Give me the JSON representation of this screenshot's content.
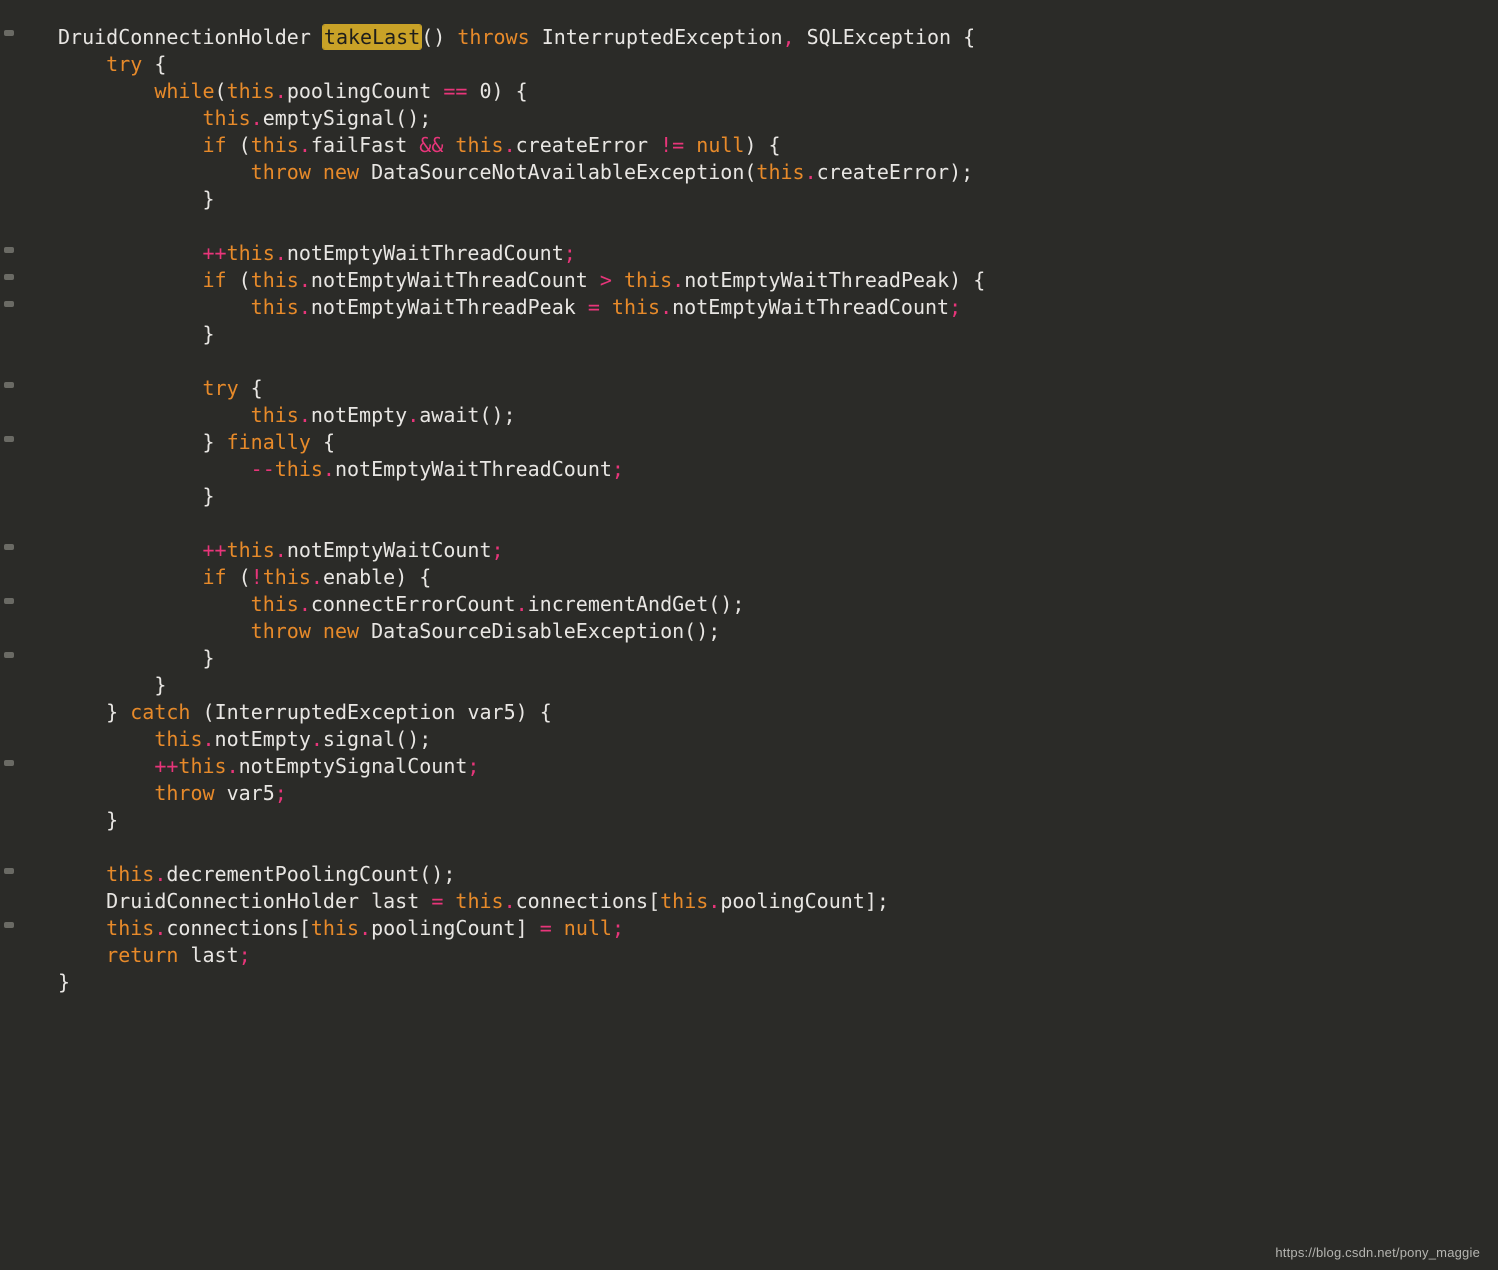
{
  "code": {
    "t": {
      "DruidConnectionHolder": "DruidConnectionHolder",
      "takeLast": "takeLast",
      "throws": "throws",
      "InterruptedException": "InterruptedException",
      "SQLException": "SQLException",
      "try": "try",
      "while": "while",
      "this": "this",
      "poolingCount": "poolingCount",
      "zero": "0",
      "emptySignal": "emptySignal",
      "if": "if",
      "failFast": "failFast",
      "createError": "createError",
      "null": "null",
      "throw": "throw",
      "new": "new",
      "DataSourceNotAvailableException": "DataSourceNotAvailableException",
      "notEmptyWaitThreadCount": "notEmptyWaitThreadCount",
      "notEmptyWaitThreadPeak": "notEmptyWaitThreadPeak",
      "notEmpty": "notEmpty",
      "await": "await",
      "finally": "finally",
      "notEmptyWaitCount": "notEmptyWaitCount",
      "enable": "enable",
      "connectErrorCount": "connectErrorCount",
      "incrementAndGet": "incrementAndGet",
      "DataSourceDisableException": "DataSourceDisableException",
      "catch": "catch",
      "var5": "var5",
      "signal": "signal",
      "notEmptySignalCount": "notEmptySignalCount",
      "decrementPoolingCount": "decrementPoolingCount",
      "last": "last",
      "connections": "connections",
      "return": "return"
    }
  },
  "watermark": "https://blog.csdn.net/pony_maggie"
}
